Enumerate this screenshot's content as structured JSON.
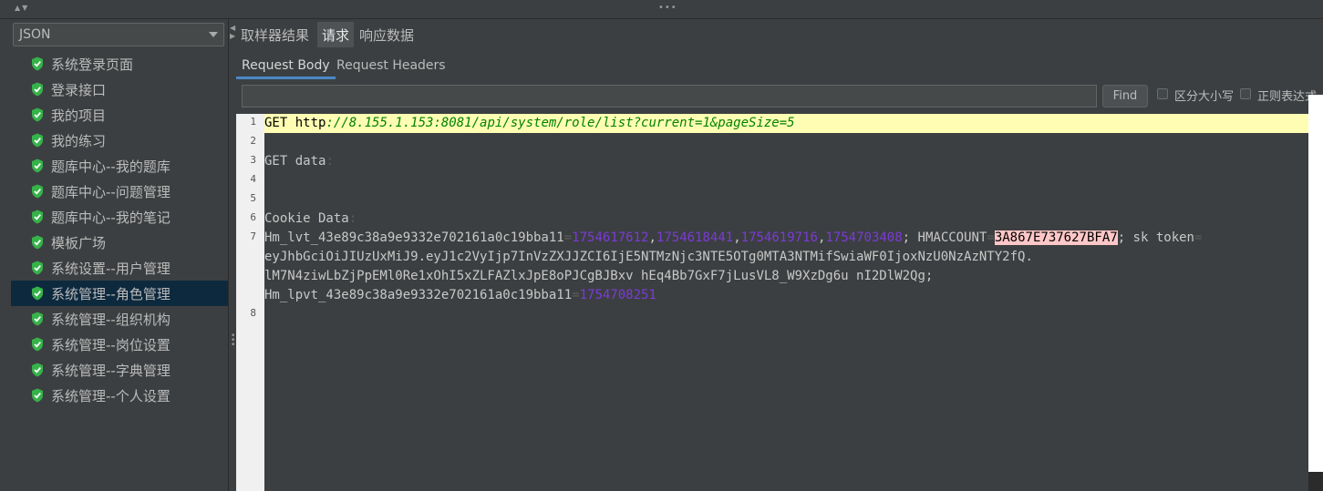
{
  "sidebar": {
    "combo_value": "JSON",
    "items": [
      {
        "label": "系统登录页面"
      },
      {
        "label": "登录接口"
      },
      {
        "label": "我的项目"
      },
      {
        "label": "我的练习"
      },
      {
        "label": "题库中心--我的题库"
      },
      {
        "label": "题库中心--问题管理"
      },
      {
        "label": "题库中心--我的笔记"
      },
      {
        "label": "模板广场"
      },
      {
        "label": "系统设置--用户管理"
      },
      {
        "label": "系统管理--角色管理",
        "selected": true
      },
      {
        "label": "系统管理--组织机构"
      },
      {
        "label": "系统管理--岗位设置"
      },
      {
        "label": "系统管理--字典管理"
      },
      {
        "label": "系统管理--个人设置"
      }
    ]
  },
  "tabs": {
    "sampler_result": "取样器结果",
    "request": "请求",
    "response_data": "响应数据"
  },
  "subtabs": {
    "request_body": "Request Body",
    "request_headers": "Request Headers"
  },
  "find": {
    "input_value": "",
    "button": "Find",
    "case_label": "区分大小写",
    "regex_label": "正则表达式"
  },
  "editor": {
    "line_numbers": [
      "1",
      "2",
      "3",
      "4",
      "5",
      "6",
      "7",
      "8"
    ],
    "l1_method": "GET ",
    "l1_scheme": "http",
    "l1_url": "://8.155.1.153:8081/api/system/role/list?current=1&pageSize=5",
    "l3": "GET data",
    "l6": "Cookie Data",
    "l7a_key": "Hm_lvt_43e89c38a9e9332e702161a0c19bba11",
    "l7a_v1": "1754617612",
    "l7a_v2": "1754618441",
    "l7a_v3": "1754619716",
    "l7a_v4": "1754703408",
    "l7a_sep": "; HMACCOUNT",
    "l7a_hm": "3A867E737627BFA7",
    "l7a_tok": "; sk token",
    "l7b": "eyJhbGciOiJIUzUxMiJ9.eyJ1c2VyIjp7InVzZXJJZCI6IjE5NTMzNjc3NTE5OTg0MTA3NTMifSwiaWF0IjoxNzU0NzAzNTY2fQ.",
    "l7c": "lM7N4ziwLbZjPpEMl0Re1xOhI5xZLFAZlxJpE8oPJCgBJBxv hEq4Bb7GxF7jLusVL8_W9XzDg6u nI2DlW2Qg;",
    "l7d_key": "Hm_lpvt_43e89c38a9e9332e702161a0c19bba11",
    "l7d_val": "1754708251"
  },
  "colors": {
    "selection": "#0d293e",
    "highlight_line": "#fffdb3",
    "url": "#008200",
    "cookie_value": "#7a3bd6",
    "search_match": "#ffc7c7",
    "shield": "#36b24a"
  }
}
